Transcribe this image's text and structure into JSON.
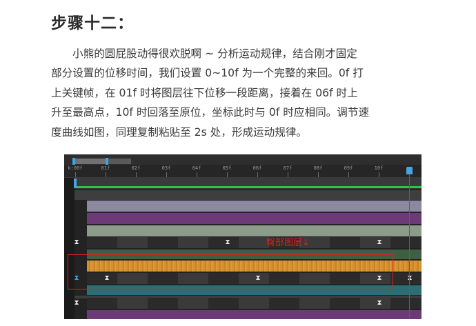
{
  "heading": "步骤十二：",
  "paragraph_lines": [
    "小熊的圆屁股动得很欢脱啊 ~ 分析运动规律，结合刚才固定",
    "部分设置的位移时间，我们设置 0~10f 为一个完整的来回。0f 打",
    "上关键帧，在 01f 时将图层往下位移一段距离，接着在 06f 时上",
    "升至最高点，10f 时回落至原位，坐标此时与 0f 时应相同。调节速",
    "度曲线如图，同理复制粘贴至 2s 处，形成运动规律。"
  ],
  "timeline": {
    "ruler_labels": [
      "k:00f",
      "01f",
      "02f",
      "03f",
      "04f",
      "05f",
      "06f",
      "07f",
      "08f",
      "09f",
      "10f"
    ],
    "annotation": "臀部图层↓",
    "keyframe_glyph": "⧗",
    "colors": {
      "lavender": "#8b88a0",
      "purple": "#6d3a78",
      "sage": "#8d9b8a",
      "green_line": "#2fc24a",
      "orange": "#d7902e",
      "dark_green": "#3f5f44",
      "teal": "#2e6d73",
      "highlight": "#d42626",
      "playhead": "#4aa3df"
    }
  }
}
